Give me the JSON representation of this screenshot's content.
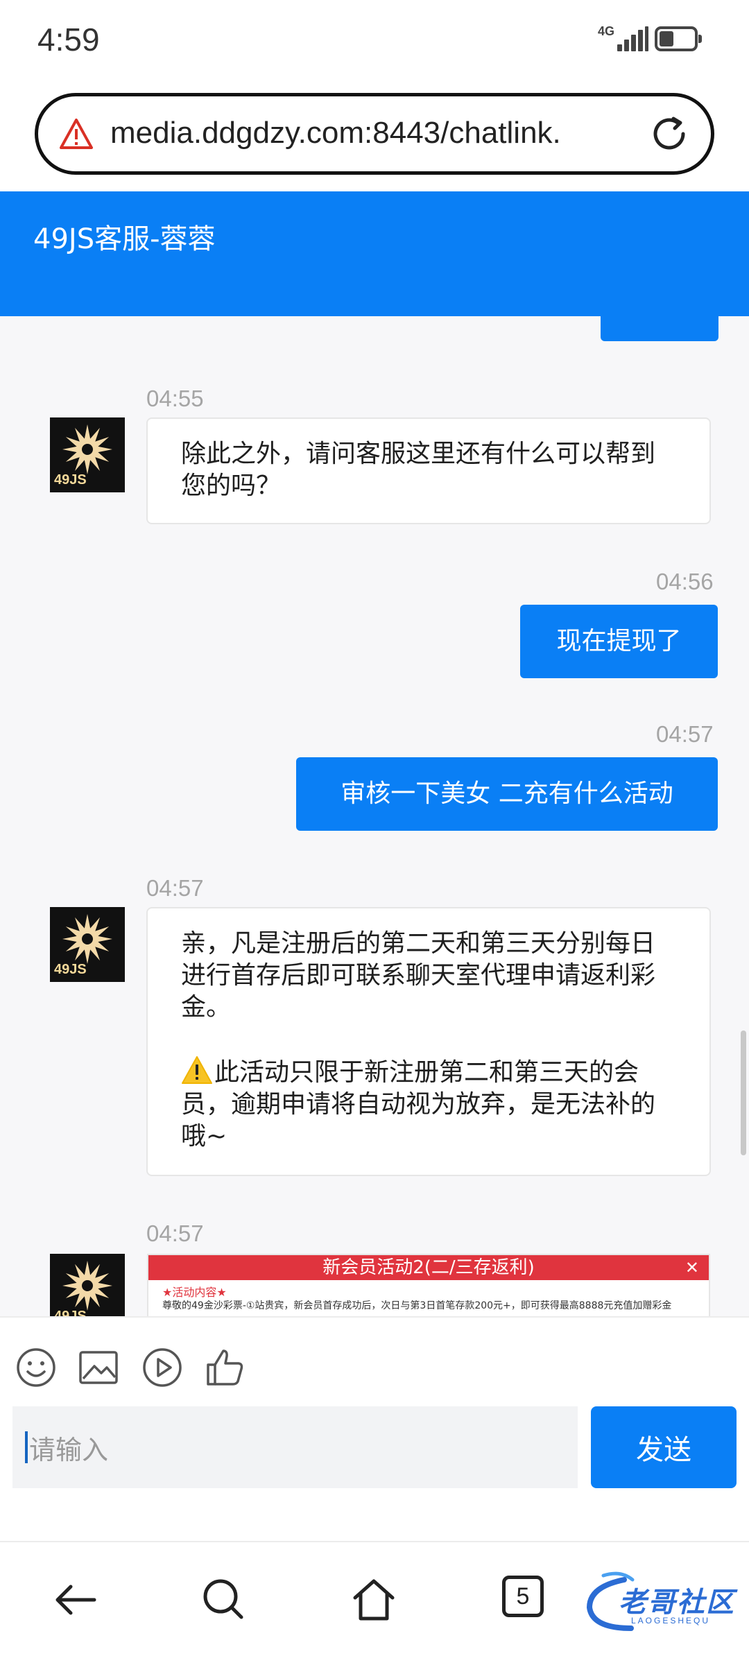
{
  "status_bar": {
    "time": "4:59",
    "network": "4G"
  },
  "browser": {
    "url": "media.ddgdzy.com:8443/chatlink.",
    "tab_count": "5"
  },
  "chat": {
    "title": "49JS客服-蓉蓉",
    "agent_brand": "49JS",
    "messages": [
      {
        "time": "04:55",
        "side": "in",
        "text": "除此之外，请问客服这里还有什么可以帮到您的吗？"
      },
      {
        "time": "04:56",
        "side": "out",
        "text": "现在提现了"
      },
      {
        "time": "04:57",
        "side": "out",
        "text": "审核一下美女 二充有什么活动"
      },
      {
        "time": "04:57",
        "side": "in",
        "text_p1": "亲，凡是注册后的第二天和第三天分别每日进行首存后即可联系聊天室代理申请返利彩金。",
        "text_p2": "此活动只限于新注册第二和第三天的会员，逾期申请将自动视为放弃，是无法补的哦~"
      },
      {
        "time": "04:57",
        "side": "in",
        "card_title": "新会员活动2(二/三存返利)",
        "card_sub": "★活动内容★",
        "card_line": "尊敬的49金沙彩票-①站贵宾，新会员首存成功后，次日与第3日首笔存款200元+，即可获得最高8888元充值加赠彩金"
      }
    ]
  },
  "composer": {
    "placeholder": "请输入",
    "send_label": "发送"
  },
  "watermark": {
    "text": "老哥社区",
    "sub": "LAOGESHEQU"
  }
}
